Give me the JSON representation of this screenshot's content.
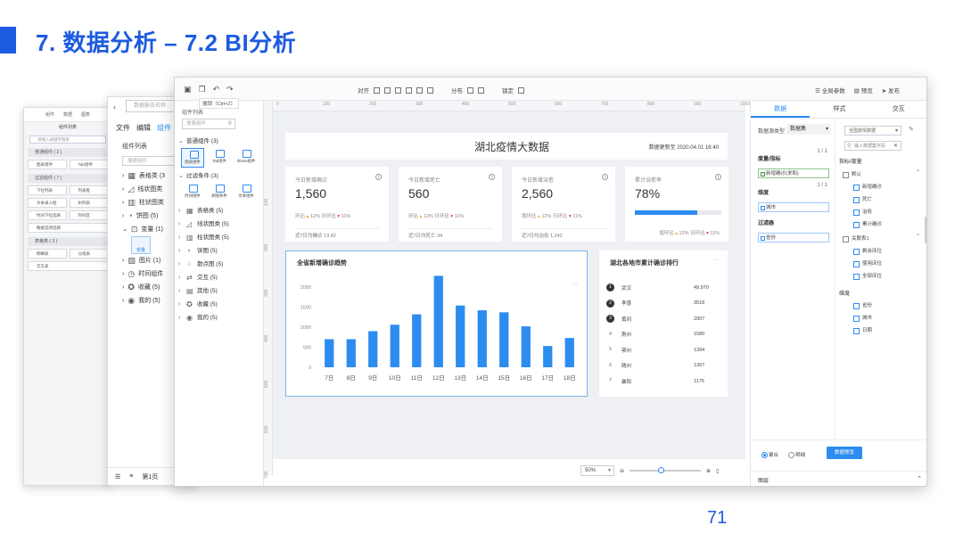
{
  "slide": {
    "title": "7. 数据分析 – 7.2 BI分析",
    "page_number": "71",
    "brand_color": "#1d5be0"
  },
  "back_window_1": {
    "header": [
      "组件",
      "数据",
      "图表"
    ],
    "subheader": "组件列表",
    "search_placeholder": "请输入关键字搜索",
    "groups": [
      {
        "label": "普通组件 ( 2 )",
        "rows": [
          [
            "图表组件",
            "Tab组件"
          ]
        ]
      },
      {
        "label": "过滤组件 ( 7 )",
        "rows": [
          [
            "下拉列表",
            "列表框"
          ],
          [
            "文本录入框",
            "树列表"
          ],
          [
            "时间下拉选择",
            "时间区"
          ],
          [
            "数据选项选择"
          ]
        ]
      },
      {
        "label": "表格类 ( 3 )",
        "rows": [
          [
            "明细表",
            "分组表"
          ],
          [
            "交叉表"
          ]
        ]
      }
    ]
  },
  "back_window_2": {
    "search_placeholder": "数据报告名称",
    "menu": [
      "文件",
      "编辑",
      "组件"
    ],
    "section": "组件列表",
    "search2_placeholder": "搜索组件",
    "items": [
      {
        "label": "表格类 (3",
        "icon": "table-icon"
      },
      {
        "label": "线状图类",
        "icon": "line-chart-icon"
      },
      {
        "label": "柱状图类",
        "icon": "bar-chart-icon"
      },
      {
        "label": "饼图 (5)",
        "icon": "pie-chart-icon"
      },
      {
        "label": "变量 (1)",
        "icon": "variable-icon"
      },
      {
        "label": "图片 (1)",
        "icon": "image-icon"
      },
      {
        "label": "时间组件",
        "icon": "clock-icon"
      },
      {
        "label": "收藏 (5)",
        "icon": "star-icon"
      },
      {
        "label": "我的 (5)",
        "icon": "user-icon"
      }
    ],
    "variable_chip": "变量",
    "bottom_page": "第1页"
  },
  "toolbar": {
    "tooltip": "撤销（Ctrl+Z）",
    "align_label": "对齐",
    "distribute_label": "分布",
    "lock_label": "锁定",
    "global_params": "全局参数",
    "preview": "预览",
    "publish": "发布"
  },
  "component_panel": {
    "label": "组件列表",
    "search_placeholder": "搜索组件",
    "tree": [
      {
        "label": "普通组件 (3)",
        "expanded": true,
        "chips": [
          "图表组件",
          "Tab组件",
          "iframe组件"
        ],
        "selected_chip": 0
      },
      {
        "label": "过滤条件 (3)",
        "expanded": true,
        "chips": [
          "时间组件",
          "刷值条件",
          "文本组件"
        ]
      },
      {
        "label": "表格类 (5)",
        "icon": "table-icon"
      },
      {
        "label": "线状图类 (5)",
        "icon": "line-chart-icon"
      },
      {
        "label": "柱状图类 (5)",
        "icon": "bar-chart-icon"
      },
      {
        "label": "饼图 (5)",
        "icon": "pie-chart-icon"
      },
      {
        "label": "散点图 (5)",
        "icon": "scatter-icon"
      },
      {
        "label": "交互 (5)",
        "icon": "interact-icon"
      },
      {
        "label": "其他 (5)",
        "icon": "grid-icon"
      },
      {
        "label": "收藏 (5)",
        "icon": "star-icon"
      },
      {
        "label": "我的 (5)",
        "icon": "user-icon"
      }
    ]
  },
  "rulers": {
    "top": [
      "0",
      "100",
      "200",
      "300",
      "400",
      "500",
      "600",
      "700",
      "800",
      "900",
      "1000"
    ],
    "left": [
      "100",
      "200",
      "300",
      "400",
      "500",
      "600",
      "700",
      "800"
    ]
  },
  "dashboard": {
    "title": "湖北疫情大数据",
    "update_time": "数据更新至 2020.04.01 16:40",
    "kpis": [
      {
        "label": "今日新增确诊",
        "value": "1,560",
        "cmp": [
          "环比",
          "12%",
          "日环比",
          "11%"
        ],
        "sub": "近7日均确诊  13.42"
      },
      {
        "label": "今日新增死亡",
        "value": "560",
        "cmp": [
          "环比",
          "12%",
          "日环比",
          "11%"
        ],
        "sub": "近7日均死亡  34"
      },
      {
        "label": "今日新增治愈",
        "value": "2,560",
        "cmp": [
          "增环比",
          "12%",
          "日环比",
          "11%"
        ],
        "sub": "近7日均治愈  1,242"
      },
      {
        "label": "累计治愈率",
        "value": "78%",
        "progress": 0.72,
        "cmp2": [
          "增环比",
          "12%",
          "日环比",
          "11%"
        ]
      }
    ],
    "rank": {
      "title": "湖北各地市累计确诊排行",
      "rows": [
        {
          "no": "1",
          "city": "武汉",
          "value": "49,970"
        },
        {
          "no": "2",
          "city": "孝感",
          "value": "3518"
        },
        {
          "no": "3",
          "city": "黄冈",
          "value": "2907"
        },
        {
          "no": "4",
          "city": "荆州",
          "value": "1580"
        },
        {
          "no": "5",
          "city": "鄂州",
          "value": "1394"
        },
        {
          "no": "6",
          "city": "随州",
          "value": "1307"
        },
        {
          "no": "7",
          "city": "襄阳",
          "value": "1175"
        }
      ]
    },
    "zoom": "50%"
  },
  "chart_data": {
    "type": "bar",
    "title": "全省新增确诊趋势",
    "categories": [
      "7日",
      "8日",
      "9日",
      "10日",
      "11日",
      "12日",
      "13日",
      "14日",
      "15日",
      "16日",
      "17日",
      "18日"
    ],
    "values": [
      700,
      700,
      900,
      1060,
      1320,
      2280,
      1540,
      1420,
      1370,
      1020,
      530,
      730
    ],
    "y_ticks": [
      "0",
      "500",
      "1000",
      "1500",
      "2000"
    ],
    "ylim": [
      0,
      2000
    ],
    "bar_color": "#2d8cf0",
    "grid": false
  },
  "property_panel": {
    "tabs": [
      "数据",
      "样式",
      "交互"
    ],
    "active_tab": 0,
    "dataset_label": "数据源类型",
    "dataset_value": "数据集",
    "measure_label": "度量/指标",
    "measure_count": "1 / 1",
    "measure_field": "新增确诊(求和)",
    "dimension_label": "维度",
    "dimension_count": "1 / 1",
    "dimension_field": "城市",
    "filter_label": "过滤器",
    "filter_field": "省份",
    "source_select": "全国疫情数据",
    "field_search": "输入数据集字段",
    "fields_title": "指标/度量",
    "group1": {
      "label": "默认",
      "items": [
        "新增确诊",
        "死亡",
        "治愈",
        "累计确诊"
      ]
    },
    "group2": {
      "label": "关联表1",
      "items": [
        "剩余床位",
        "使用床位",
        "全部床位"
      ]
    },
    "dim_title": "维度",
    "dim_items": [
      "省份",
      "城市",
      "日期"
    ],
    "radio_options": [
      "聚合",
      "明细"
    ],
    "radio_selected": 0,
    "button": "数据预览",
    "layer_label": "图层"
  }
}
